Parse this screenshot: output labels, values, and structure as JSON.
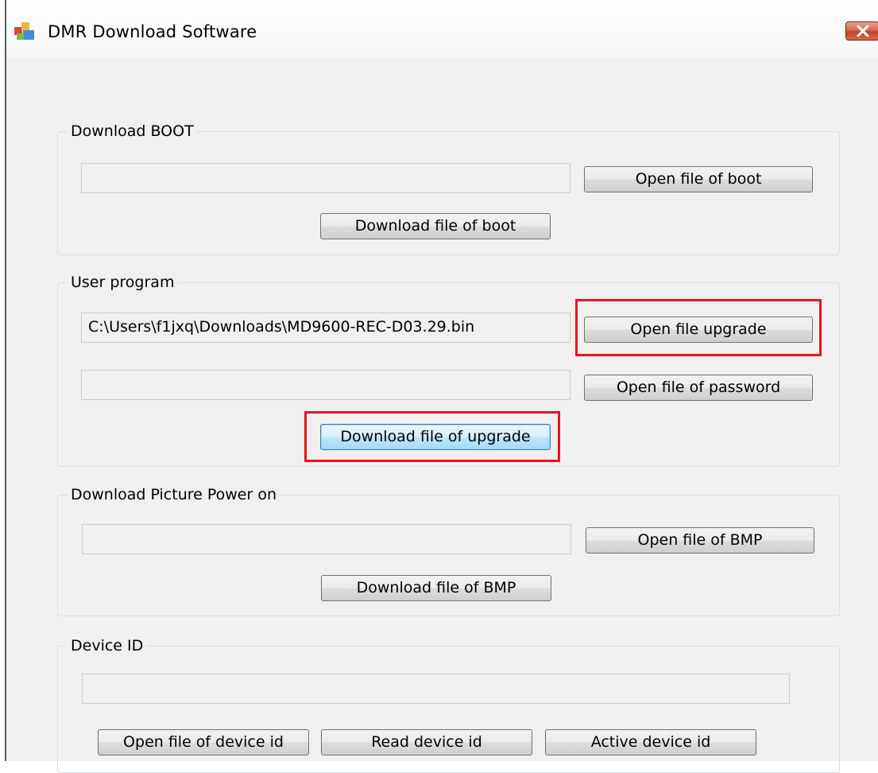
{
  "window": {
    "title": "DMR Download Software"
  },
  "colors": {
    "highlight": "#e8141f",
    "focus_border": "#3c7fb1",
    "close_button": "#c2432a"
  },
  "icons": {
    "app": "app-icon",
    "close": "close-icon"
  },
  "boot": {
    "label": "Download BOOT",
    "file_path": "",
    "open_button": "Open file of boot",
    "download_button": "Download file of boot"
  },
  "user_program": {
    "label": "User program",
    "upgrade_path": "C:\\Users\\f1jxq\\Downloads\\MD9600-REC-D03.29.bin",
    "open_upgrade_button": "Open file upgrade",
    "password_path": "",
    "open_password_button": "Open file of password",
    "download_button": "Download file of upgrade"
  },
  "picture": {
    "label": "Download Picture Power on",
    "file_path": "",
    "open_button": "Open file of BMP",
    "download_button": "Download file of BMP"
  },
  "device_id": {
    "label": "Device ID",
    "value": "",
    "open_button": "Open file of device id",
    "read_button": "Read device id",
    "active_button": "Active device id"
  }
}
